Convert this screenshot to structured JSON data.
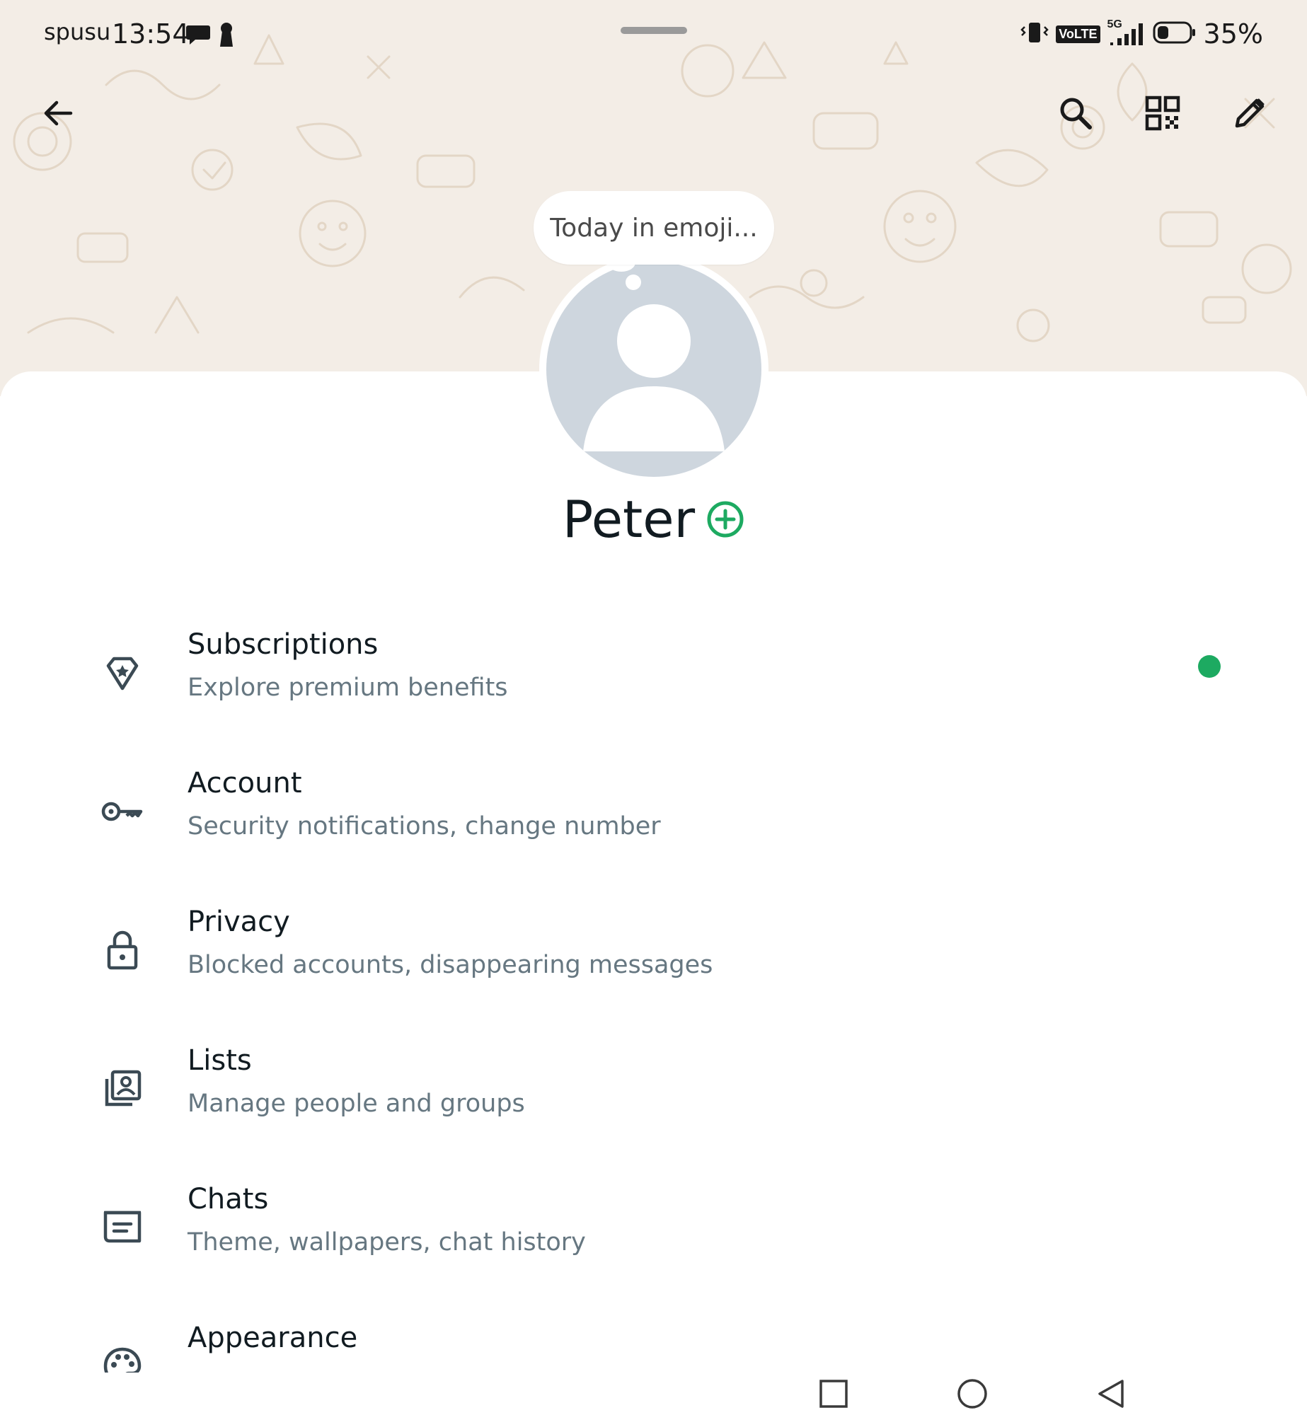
{
  "status_bar": {
    "carrier": "spusu",
    "time": "13:54",
    "network_badge": "VoLTE",
    "network_type": "5G",
    "battery_percent": "35%",
    "battery_level": 0.35,
    "icons": [
      "chat-bubble-icon",
      "keyhole-icon",
      "vibrate-icon",
      "signal-icon",
      "battery-icon"
    ]
  },
  "app_bar": {
    "icons": [
      "back-arrow-icon",
      "search-icon",
      "qr-code-icon",
      "edit-pencil-icon"
    ]
  },
  "profile": {
    "status_bubble": "Today in emoji...",
    "name": "Peter",
    "add_icon": "add-circle-icon"
  },
  "settings": {
    "items": [
      {
        "title": "Subscriptions",
        "subtitle": "Explore premium benefits",
        "icon": "diamond-star-icon",
        "has_dot": true
      },
      {
        "title": "Account",
        "subtitle": "Security notifications, change number",
        "icon": "key-icon"
      },
      {
        "title": "Privacy",
        "subtitle": "Blocked accounts, disappearing messages",
        "icon": "lock-icon"
      },
      {
        "title": "Lists",
        "subtitle": "Manage people and groups",
        "icon": "contact-list-icon"
      },
      {
        "title": "Chats",
        "subtitle": "Theme, wallpapers, chat history",
        "icon": "chat-box-icon"
      },
      {
        "title": "Appearance",
        "subtitle": "",
        "icon": "palette-icon"
      }
    ]
  },
  "nav_bar": {
    "icons": [
      "recents-square-icon",
      "home-circle-icon",
      "back-triangle-icon"
    ]
  },
  "colors": {
    "accent_green": "#1daa61",
    "hero_background": "#f3ede6",
    "doodle_stroke": "#e3d6c6",
    "avatar_background": "#ced6de",
    "subtitle_gray": "#667781"
  }
}
